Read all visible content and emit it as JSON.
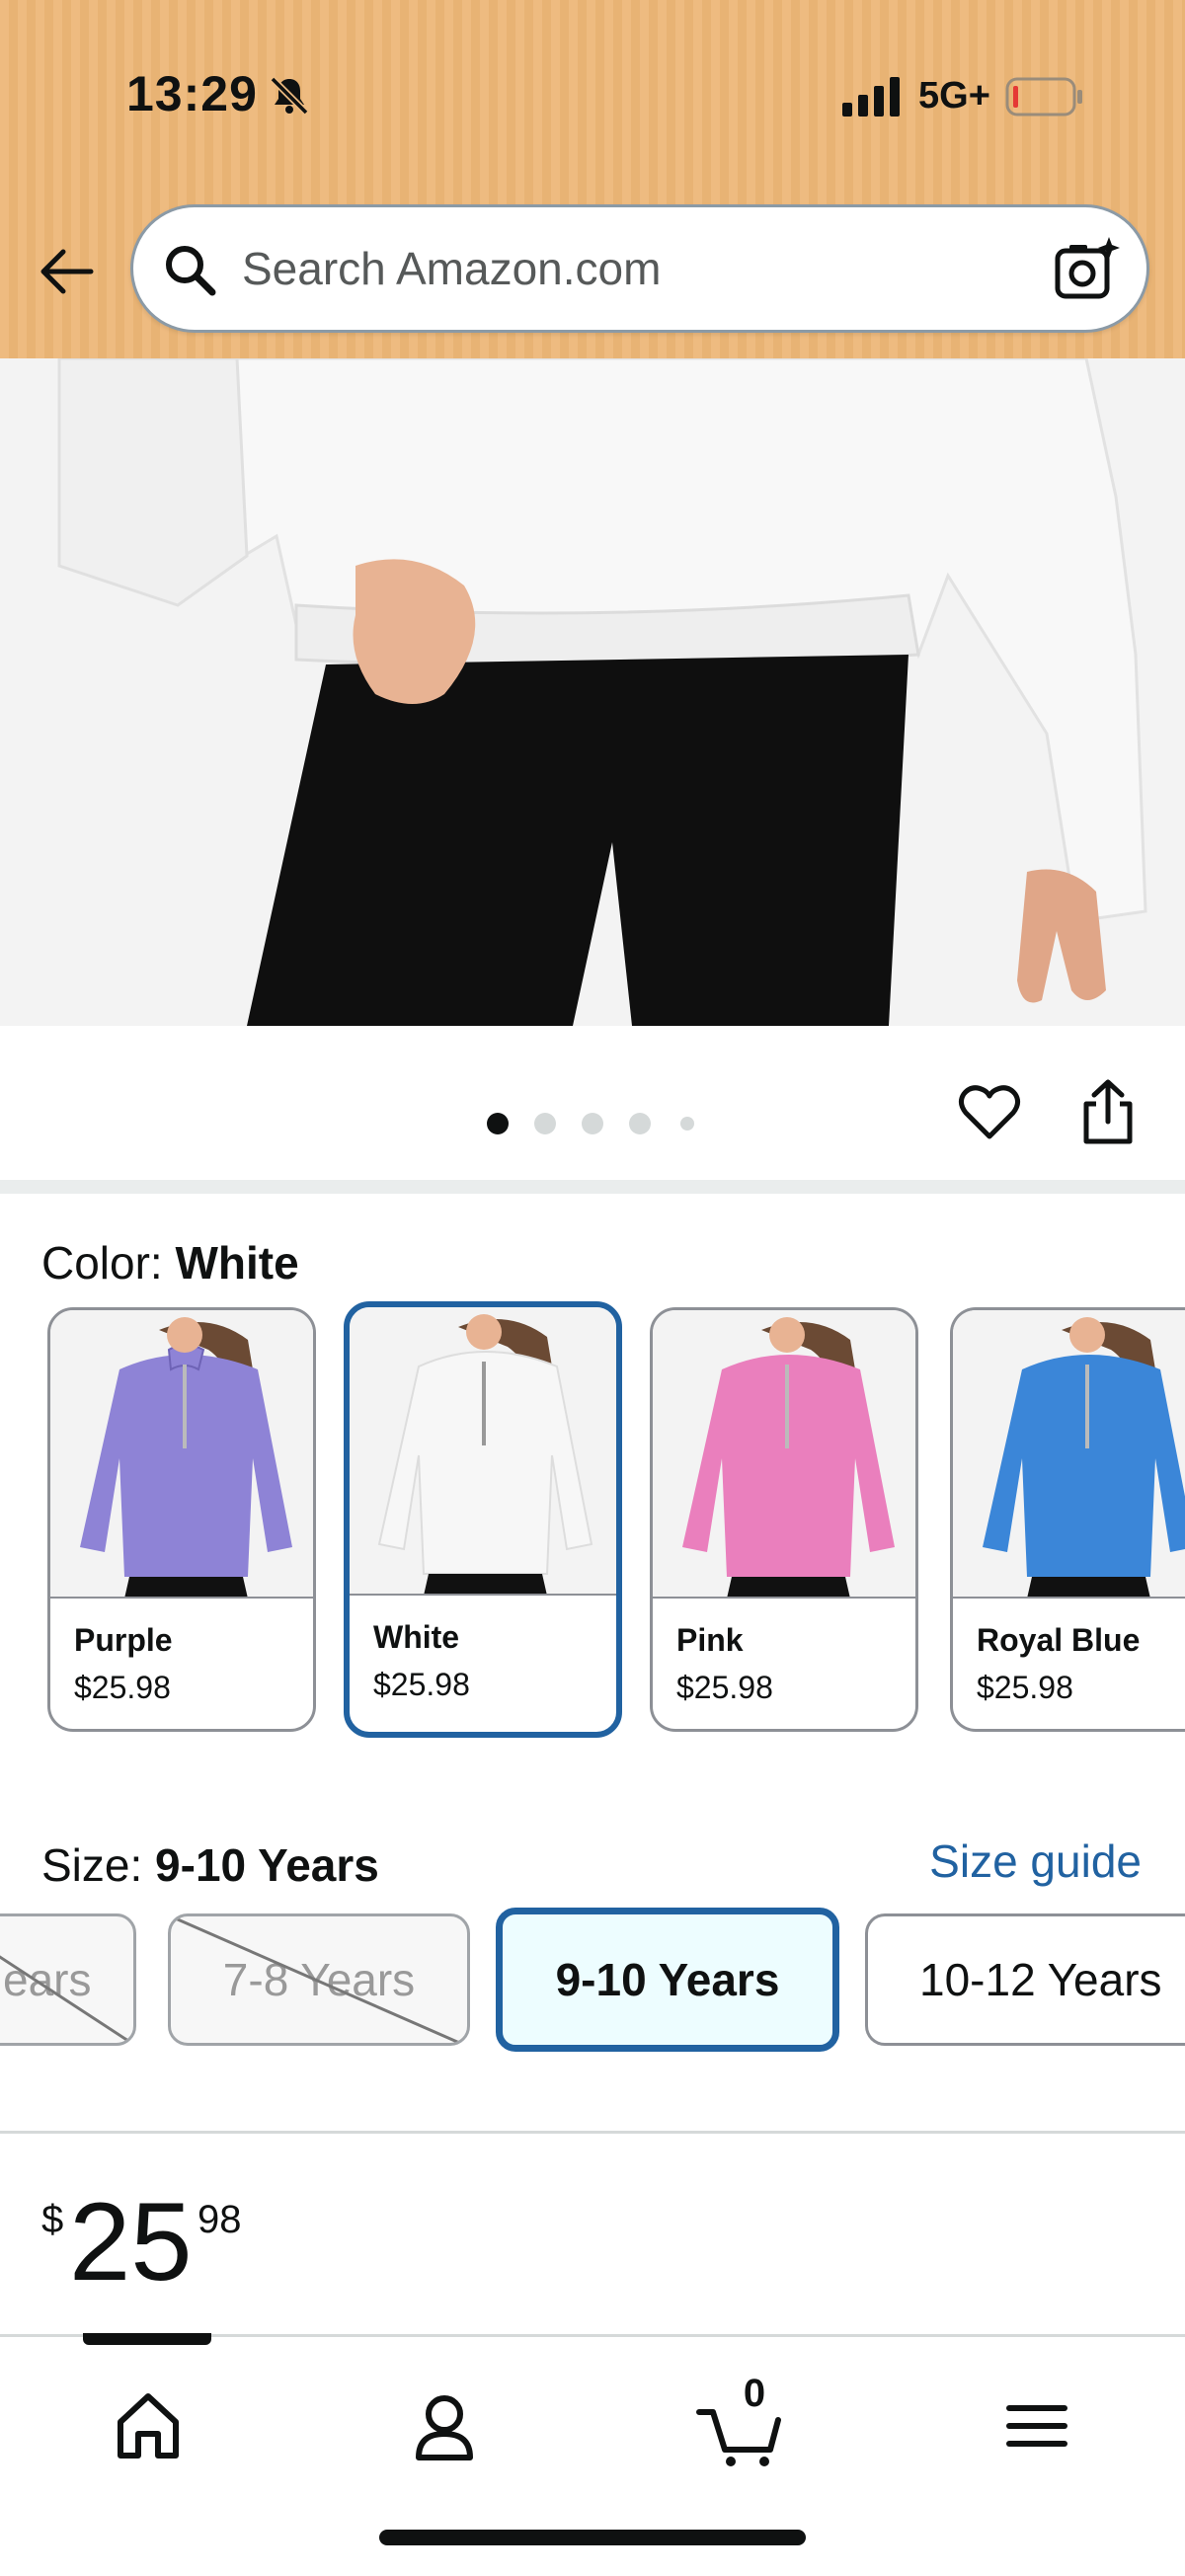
{
  "status_bar": {
    "time": "13:29",
    "network": "5G+"
  },
  "search": {
    "placeholder": "Search Amazon.com"
  },
  "gallery": {
    "image_count": 5,
    "active_index": 0
  },
  "color": {
    "label": "Color: ",
    "selected": "White",
    "options": [
      {
        "name": "Purple",
        "price": "$25.98",
        "color": "#8e83d6"
      },
      {
        "name": "White",
        "price": "$25.98",
        "color": "#f5f5f5"
      },
      {
        "name": "Pink",
        "price": "$25.98",
        "color": "#ea7fbd"
      },
      {
        "name": "Royal Blue",
        "price": "$25.98",
        "color": "#3b86d8"
      }
    ]
  },
  "size": {
    "label": "Size: ",
    "selected": "9-10 Years",
    "guide_label": "Size guide",
    "options": [
      {
        "label": "ears",
        "available": false
      },
      {
        "label": "7-8 Years",
        "available": false
      },
      {
        "label": "9-10 Years",
        "available": true
      },
      {
        "label": "10-12 Years",
        "available": true
      }
    ]
  },
  "price": {
    "symbol": "$",
    "whole": "25",
    "fraction": "98"
  },
  "cart": {
    "count": "0"
  },
  "colors": {
    "header_bg": "#eebb80",
    "selected_border": "#2162a1",
    "link": "#2162a1"
  }
}
